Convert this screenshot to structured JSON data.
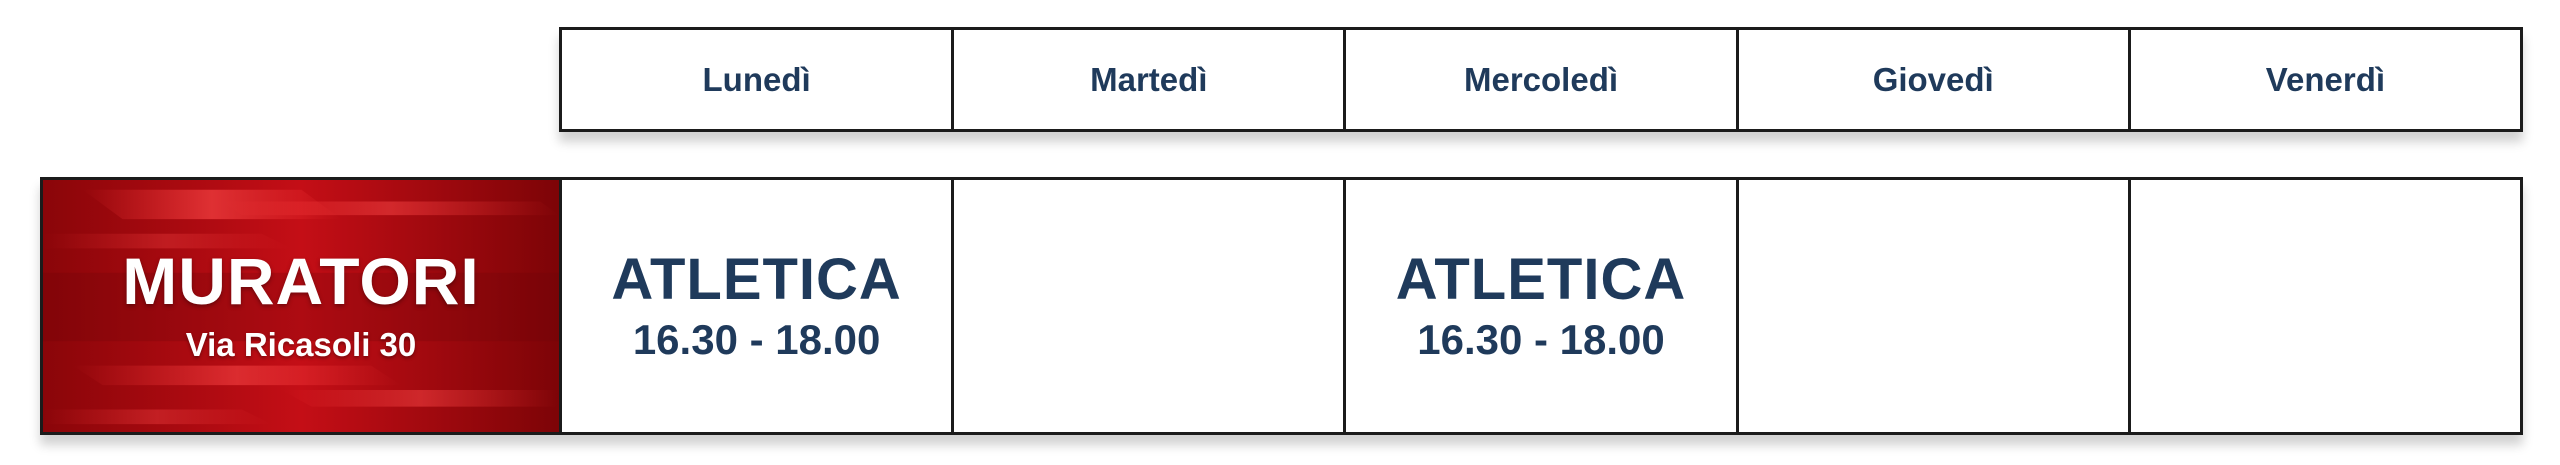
{
  "days": [
    "Lunedì",
    "Martedì",
    "Mercoledì",
    "Giovedì",
    "Venerdì"
  ],
  "location": {
    "name": "MURATORI",
    "address": "Via Ricasoli 30"
  },
  "slots": [
    {
      "activity": "ATLETICA",
      "time": "16.30 - 18.00"
    },
    {
      "activity": "",
      "time": ""
    },
    {
      "activity": "ATLETICA",
      "time": "16.30 - 18.00"
    },
    {
      "activity": "",
      "time": ""
    },
    {
      "activity": "",
      "time": ""
    }
  ],
  "colors": {
    "text_primary": "#1f3a5b",
    "location_bg": "#b30b12",
    "border": "#1b1b1b"
  }
}
